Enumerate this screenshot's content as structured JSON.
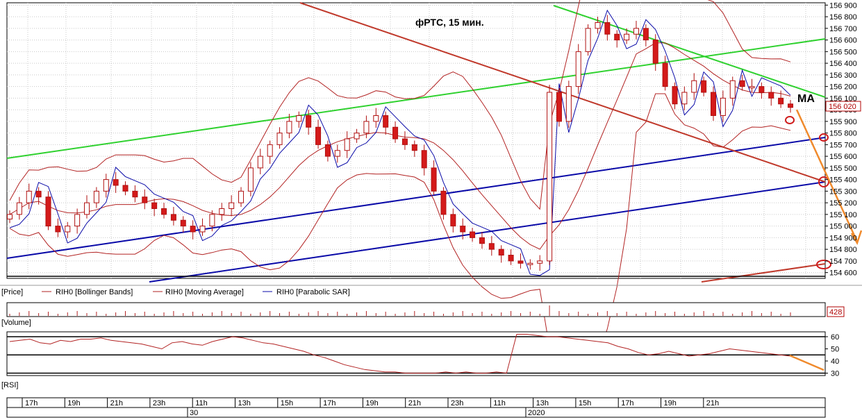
{
  "chart_data": {
    "type": "candlestick",
    "title": "фРТС,  15 мин.",
    "annotation": "MA",
    "price_axis": {
      "ticks": [
        154600,
        154700,
        154800,
        154900,
        155000,
        155100,
        155200,
        155300,
        155400,
        155500,
        155600,
        155700,
        155800,
        155900,
        156000,
        156100,
        156200,
        156300,
        156400,
        156500,
        156600,
        156700,
        156800,
        156900
      ],
      "tick_labels": [
        "154 600",
        "154 700",
        "154 800",
        "154 900",
        "155 000",
        "155 100",
        "155 200",
        "155 300",
        "155 400",
        "155 500",
        "155 600",
        "155 700",
        "155 800",
        "155 900",
        "156 000",
        "156 100",
        "156 200",
        "156 300",
        "156 400",
        "156 500",
        "156 600",
        "156 700",
        "156 800",
        "156 900"
      ],
      "ylim": [
        154550,
        156920
      ],
      "last_price": 156020,
      "last_price_label": "156 020"
    },
    "legend": [
      "[Price]",
      "RIH0 [Bollinger Bands]",
      "RIH0 [Moving Average]",
      "RIH0 [Parabolic SAR]"
    ],
    "volume": {
      "label": "[Volume]",
      "last_value_label": "428"
    },
    "rsi": {
      "label": "[RSI]",
      "ylim": [
        28,
        64
      ],
      "levels": [
        60,
        45,
        30
      ],
      "tick_labels": [
        "60",
        "50",
        "40",
        "30"
      ],
      "tick_values": [
        60,
        50,
        40,
        30
      ],
      "values": [
        56,
        57,
        58,
        55,
        54,
        57,
        56,
        58,
        58,
        59,
        57,
        56,
        55,
        54,
        52,
        50,
        55,
        56,
        54,
        53,
        56,
        58,
        60,
        59,
        57,
        55,
        54,
        52,
        50,
        48,
        45,
        43,
        40,
        37,
        35,
        33,
        32,
        31,
        31,
        30,
        30,
        30,
        30,
        31,
        30,
        31,
        30,
        30,
        31,
        30,
        62,
        62,
        61,
        60,
        60,
        59,
        58,
        57,
        56,
        55,
        52,
        50,
        47,
        45,
        46,
        48,
        46,
        44,
        45,
        46,
        48,
        50,
        49,
        48,
        47,
        46,
        45,
        44
      ]
    },
    "time_axis": {
      "labels": [
        "17h",
        "19h",
        "21h",
        "23h",
        "11h",
        "13h",
        "15h",
        "17h",
        "19h",
        "21h",
        "23h",
        "11h",
        "13h",
        "15h",
        "17h",
        "19h",
        "21h"
      ],
      "dates": [
        "30",
        "2020"
      ]
    },
    "series": [
      {
        "values": [
          155100,
          155200,
          155300,
          155250,
          155000,
          154950,
          155000,
          155100,
          155200,
          155300,
          155400,
          155350,
          155300,
          155250,
          155200,
          155150,
          155100,
          155050,
          155000,
          154950,
          155000,
          155100,
          155150,
          155200,
          155300,
          155500,
          155600,
          155700,
          155800,
          155900,
          155950,
          155850,
          155700,
          155600,
          155650,
          155750,
          155800,
          155900,
          155950,
          155850,
          155750,
          155700,
          155650,
          155500,
          155300,
          155100,
          155000,
          154950,
          154900,
          154850,
          154800,
          154750,
          154700,
          154680,
          154680,
          154700,
          156150,
          155900,
          156200,
          156500,
          156700,
          156750,
          156650,
          156600,
          156650,
          156700,
          156600,
          156400,
          156200,
          156050,
          156150,
          156250,
          156150,
          155950,
          156100,
          156250,
          156200,
          156200,
          156150,
          156100,
          156050,
          156020
        ]
      }
    ]
  }
}
